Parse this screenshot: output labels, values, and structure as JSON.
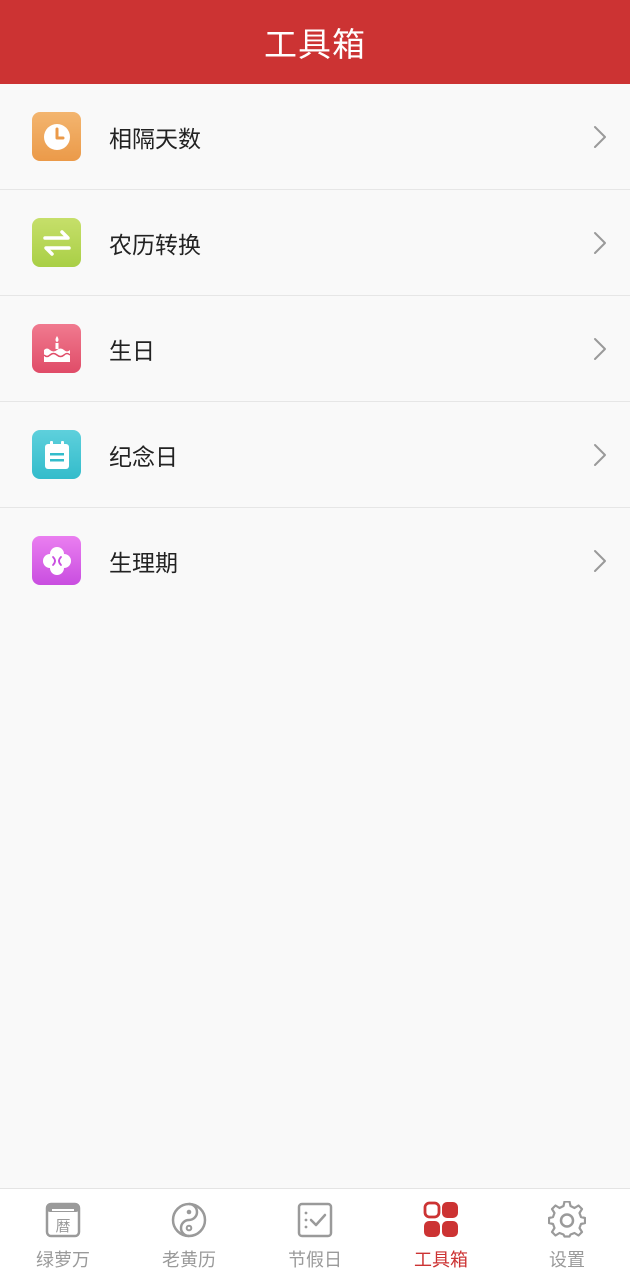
{
  "header": {
    "title": "工具箱"
  },
  "tools": [
    {
      "label": "相隔天数",
      "icon": "clock-icon",
      "color": "#ef9f4f"
    },
    {
      "label": "农历转换",
      "icon": "swap-arrows-icon",
      "color": "#b2d450"
    },
    {
      "label": "生日",
      "icon": "birthday-cake-icon",
      "color": "#e55572"
    },
    {
      "label": "纪念日",
      "icon": "notepad-icon",
      "color": "#3bc1cf"
    },
    {
      "label": "生理期",
      "icon": "flower-icon",
      "color": "#d05ae4"
    }
  ],
  "tabbar": {
    "tabs": [
      {
        "label": "绿萝万",
        "icon": "calendar-icon",
        "active": false
      },
      {
        "label": "老黄历",
        "icon": "yin-yang-icon",
        "active": false
      },
      {
        "label": "节假日",
        "icon": "checklist-icon",
        "active": false
      },
      {
        "label": "工具箱",
        "icon": "grid-icon",
        "active": true
      },
      {
        "label": "设置",
        "icon": "gear-icon",
        "active": false
      }
    ],
    "active_color": "#cc3333",
    "inactive_color": "#9a9a9a",
    "calendar_glyph": "暦"
  },
  "colors": {
    "header": "#cc3333",
    "background": "#f9f9f9"
  }
}
